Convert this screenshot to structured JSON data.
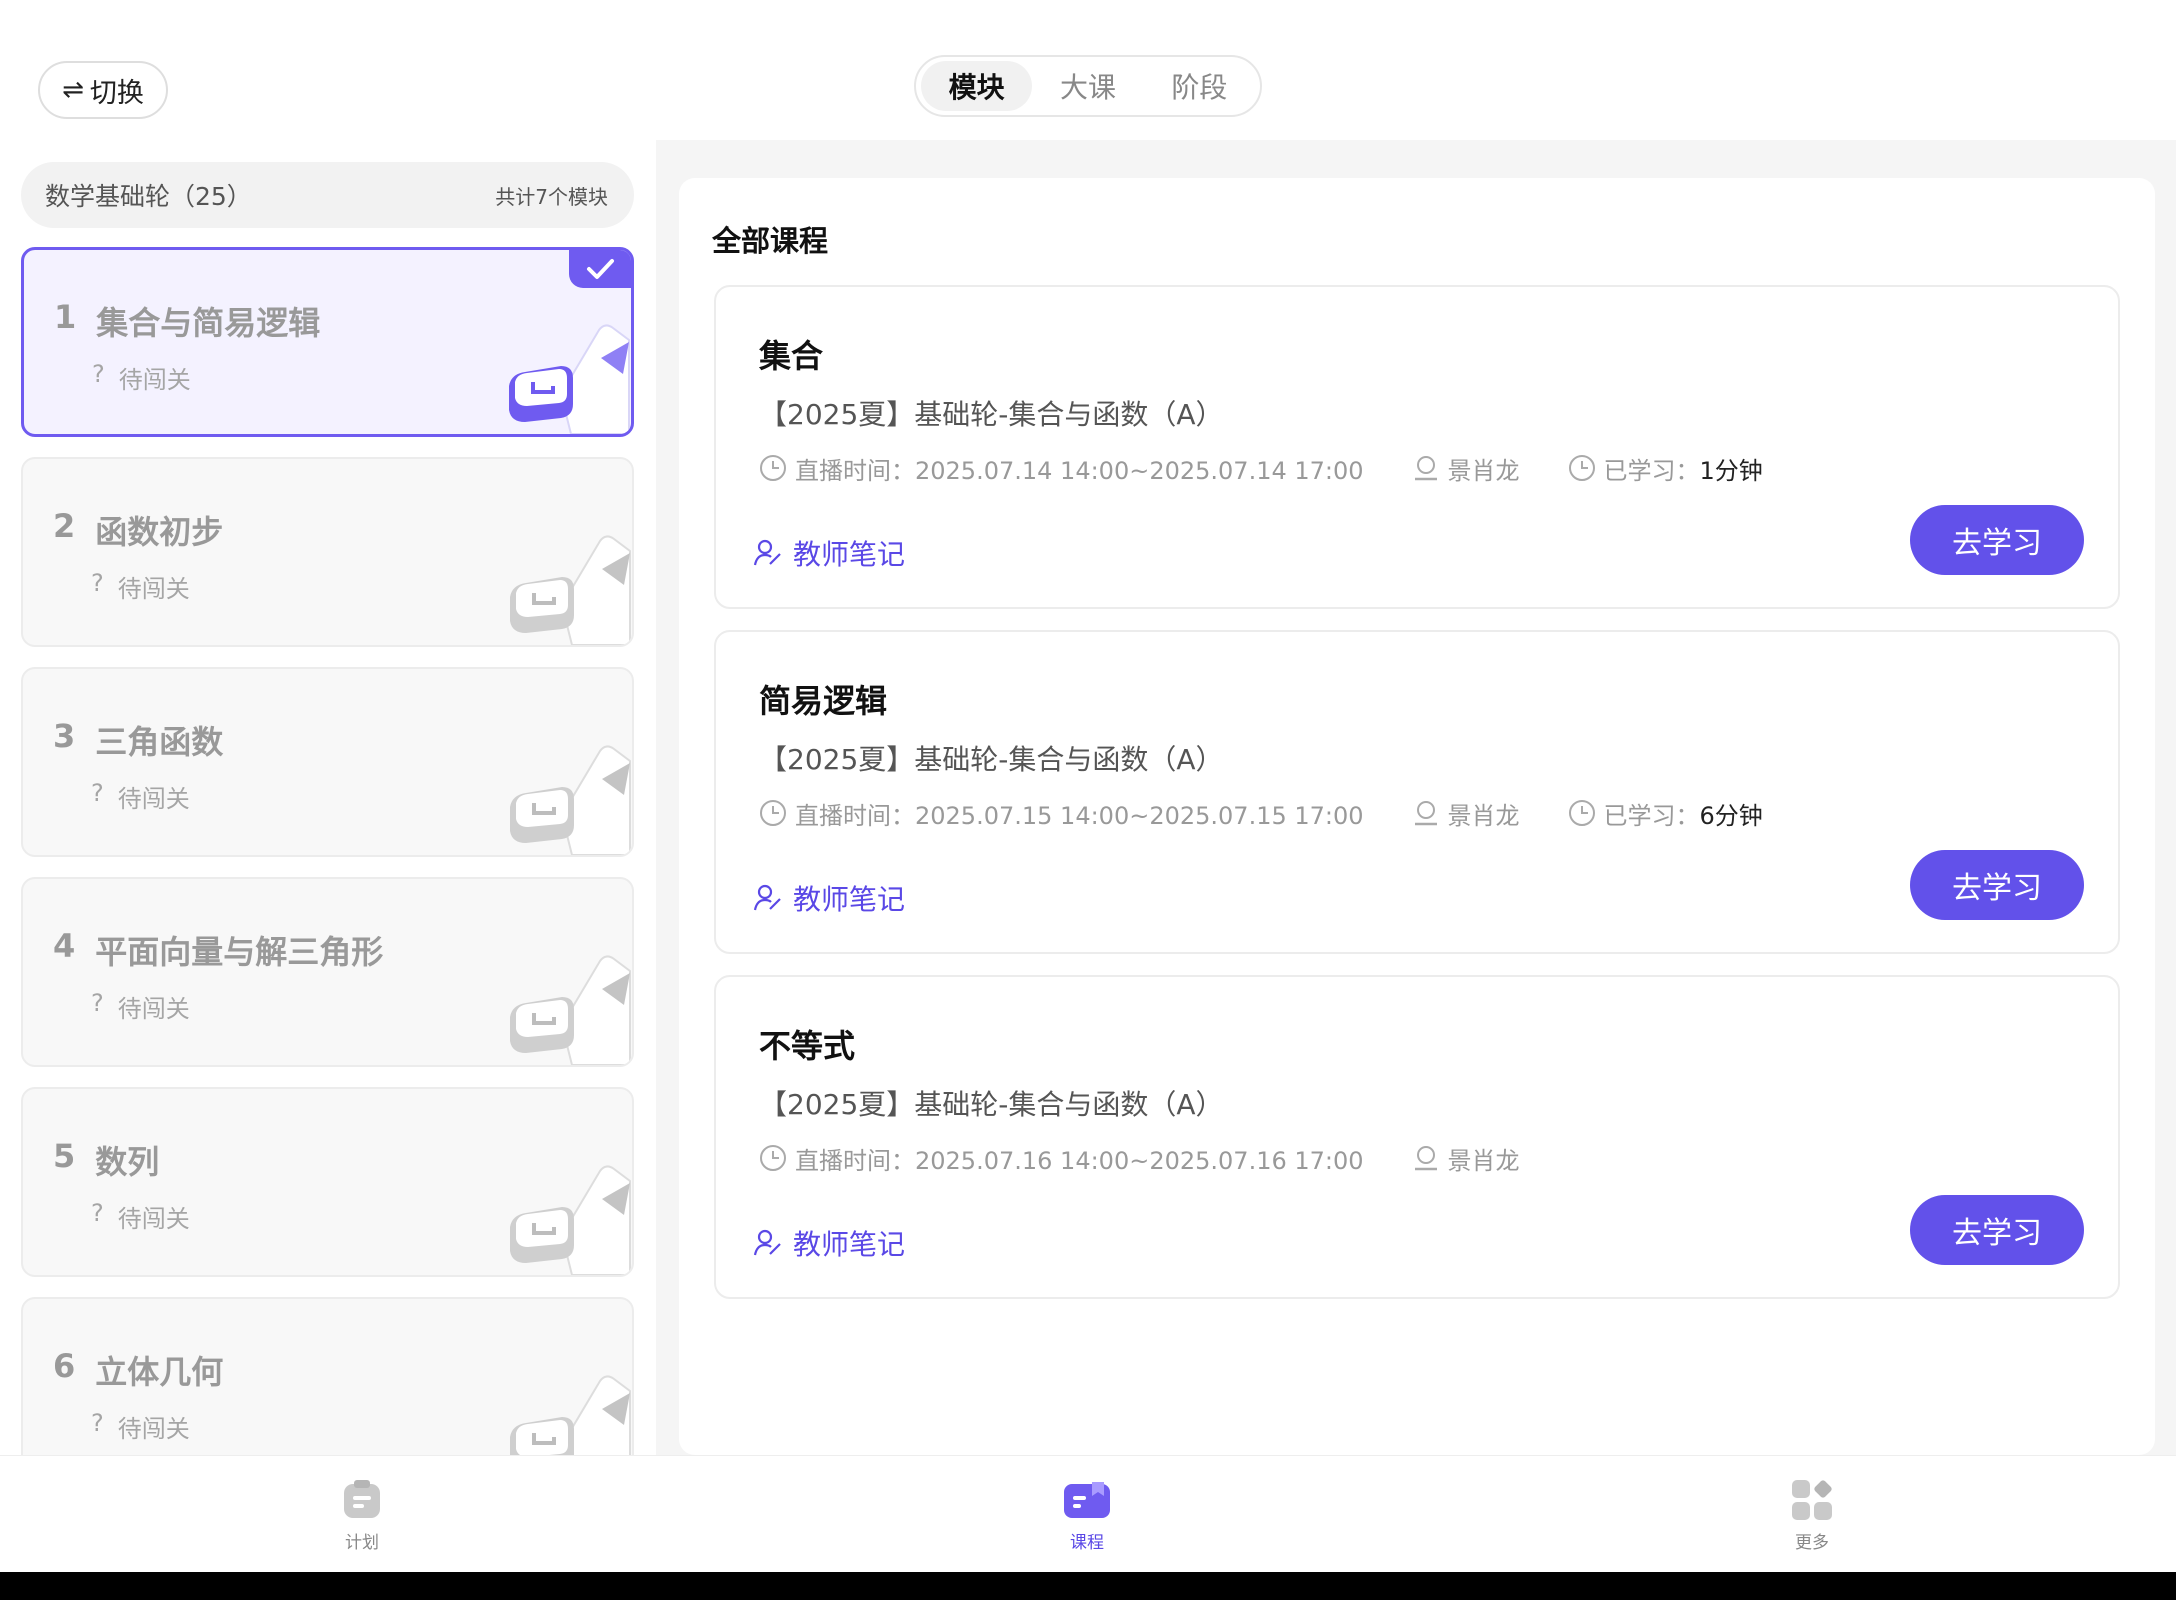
{
  "header": {
    "switch_label": "切换",
    "switch_icon": "⇌",
    "tabs": [
      {
        "label": "模块",
        "active": true
      },
      {
        "label": "大课",
        "active": false
      },
      {
        "label": "阶段",
        "active": false
      }
    ]
  },
  "sidebar": {
    "group_title": "数学基础轮（25）",
    "group_count": "共计7个模块",
    "modules": [
      {
        "num": "1",
        "title": "集合与简易逻辑",
        "status_icon": "?",
        "status": "待闯关",
        "active": true
      },
      {
        "num": "2",
        "title": "函数初步",
        "status_icon": "?",
        "status": "待闯关",
        "active": false
      },
      {
        "num": "3",
        "title": "三角函数",
        "status_icon": "?",
        "status": "待闯关",
        "active": false
      },
      {
        "num": "4",
        "title": "平面向量与解三角形",
        "status_icon": "?",
        "status": "待闯关",
        "active": false
      },
      {
        "num": "5",
        "title": "数列",
        "status_icon": "?",
        "status": "待闯关",
        "active": false
      },
      {
        "num": "6",
        "title": "立体几何",
        "status_icon": "?",
        "status": "待闯关",
        "active": false
      }
    ]
  },
  "main": {
    "section_title": "全部课程",
    "courses": [
      {
        "name": "集合",
        "subtitle": "【2025夏】基础轮-集合与函数（A）",
        "live_label": "直播时间：",
        "live_time": "2025.07.14 14:00~2025.07.14 17:00",
        "teacher": "景肖龙",
        "studied_label": "已学习：",
        "studied_value": "1分钟",
        "note_label": "教师笔记",
        "action_label": "去学习"
      },
      {
        "name": "简易逻辑",
        "subtitle": "【2025夏】基础轮-集合与函数（A）",
        "live_label": "直播时间：",
        "live_time": "2025.07.15 14:00~2025.07.15 17:00",
        "teacher": "景肖龙",
        "studied_label": "已学习：",
        "studied_value": "6分钟",
        "note_label": "教师笔记",
        "action_label": "去学习"
      },
      {
        "name": "不等式",
        "subtitle": "【2025夏】基础轮-集合与函数（A）",
        "live_label": "直播时间：",
        "live_time": "2025.07.16 14:00~2025.07.16 17:00",
        "teacher": "景肖龙",
        "note_label": "教师笔记",
        "action_label": "去学习"
      }
    ]
  },
  "bottom_nav": {
    "items": [
      {
        "label": "计划",
        "icon": "clipboard-icon",
        "active": false
      },
      {
        "label": "课程",
        "icon": "book-icon",
        "active": true
      },
      {
        "label": "更多",
        "icon": "grid-icon",
        "active": false
      }
    ]
  },
  "colors": {
    "accent": "#6251ea",
    "accent_text": "#5a48e6",
    "active_module_bg": "#f4f2ff"
  }
}
